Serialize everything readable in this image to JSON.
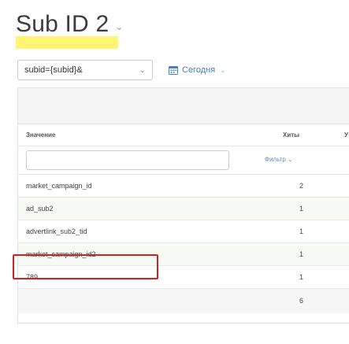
{
  "header": {
    "title": "Sub ID 2",
    "title_chevron": "⌄"
  },
  "colors": {
    "highlight": "#fff46a",
    "annotation_box": "#d42020",
    "link": "#4a7fb5",
    "alt_row": "#f6f9f4"
  },
  "toolbar": {
    "select_value": "subid={subid}&",
    "date_label": "Сегодня",
    "date_icon": "calendar-icon"
  },
  "table": {
    "columns": {
      "value": "Значение",
      "hits": "Хиты",
      "cut": "У"
    },
    "filter": {
      "input_value": "",
      "label": "Фильтр ⌄"
    },
    "rows": [
      {
        "value": "market_campaign_id",
        "hits": "2"
      },
      {
        "value": "ad_sub2",
        "hits": "1"
      },
      {
        "value": "advertlink_sub2_tid",
        "hits": "1"
      },
      {
        "value": "market_campaign_id2",
        "hits": "1"
      },
      {
        "value": "789",
        "hits": "1"
      }
    ],
    "total_hits": "6"
  }
}
